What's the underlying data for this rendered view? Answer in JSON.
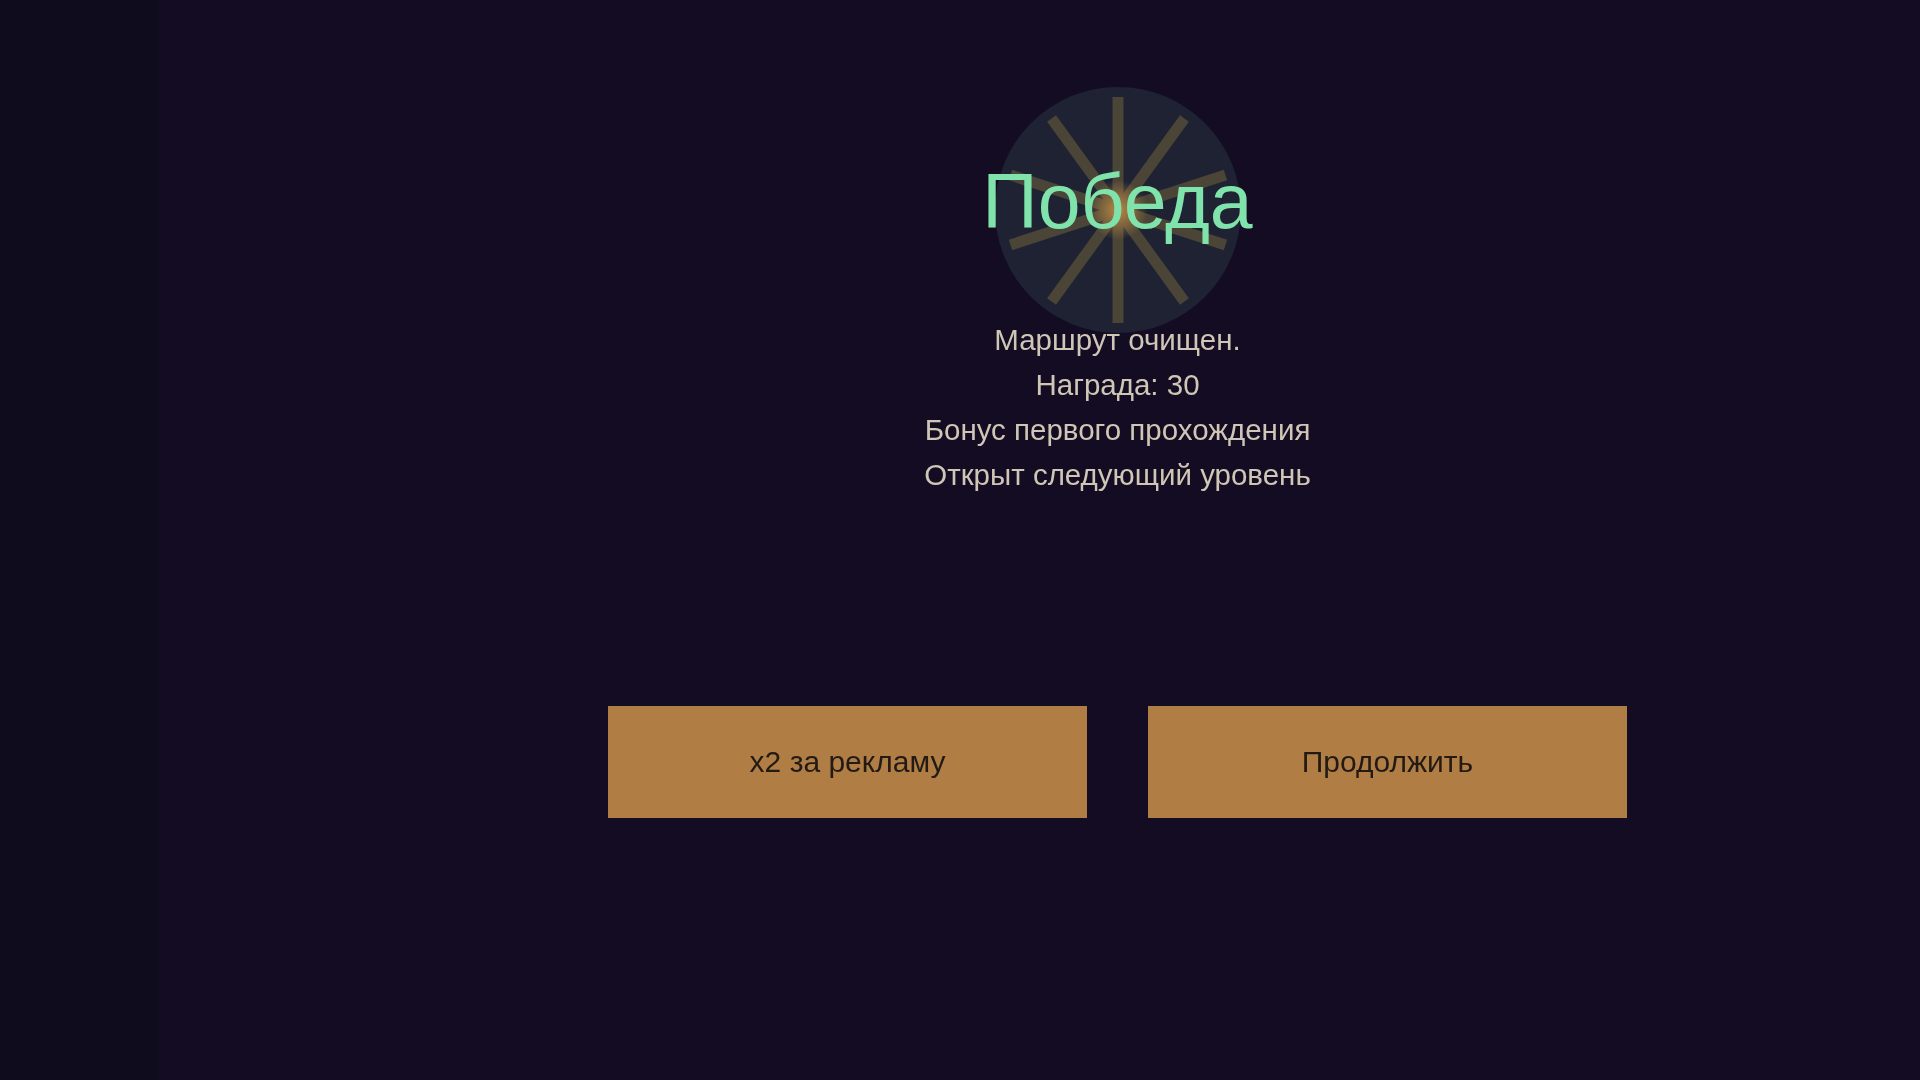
{
  "title": "Победа",
  "messages": [
    "Маршрут очищен.",
    "Награда: 30",
    "Бонус первого прохождения",
    "Открыт следующий уровень"
  ],
  "buttons": [
    {
      "label": "x2 за рекламу"
    },
    {
      "label": "Продолжить"
    }
  ]
}
